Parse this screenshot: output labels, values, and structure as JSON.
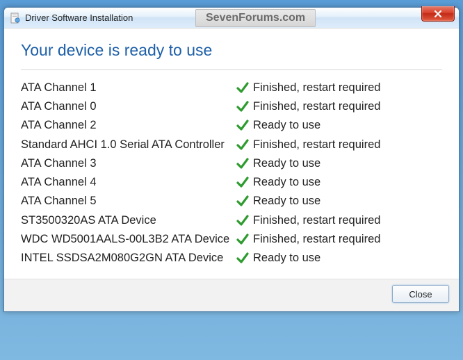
{
  "window": {
    "title": "Driver Software Installation",
    "watermark": "SevenForums.com"
  },
  "heading": "Your device is ready to use",
  "devices": [
    {
      "name": "ATA Channel 1",
      "status": "Finished, restart required"
    },
    {
      "name": "ATA Channel 0",
      "status": "Finished, restart required"
    },
    {
      "name": "ATA Channel 2",
      "status": "Ready to use"
    },
    {
      "name": "Standard AHCI 1.0 Serial ATA Controller",
      "status": "Finished, restart required"
    },
    {
      "name": "ATA Channel 3",
      "status": "Ready to use"
    },
    {
      "name": "ATA Channel 4",
      "status": "Ready to use"
    },
    {
      "name": "ATA Channel 5",
      "status": "Ready to use"
    },
    {
      "name": "ST3500320AS ATA Device",
      "status": "Finished, restart required"
    },
    {
      "name": "WDC WD5001AALS-00L3B2 ATA Device",
      "status": "Finished, restart required"
    },
    {
      "name": "INTEL SSDSA2M080G2GN ATA Device",
      "status": "Ready to use"
    }
  ],
  "buttons": {
    "close": "Close"
  }
}
